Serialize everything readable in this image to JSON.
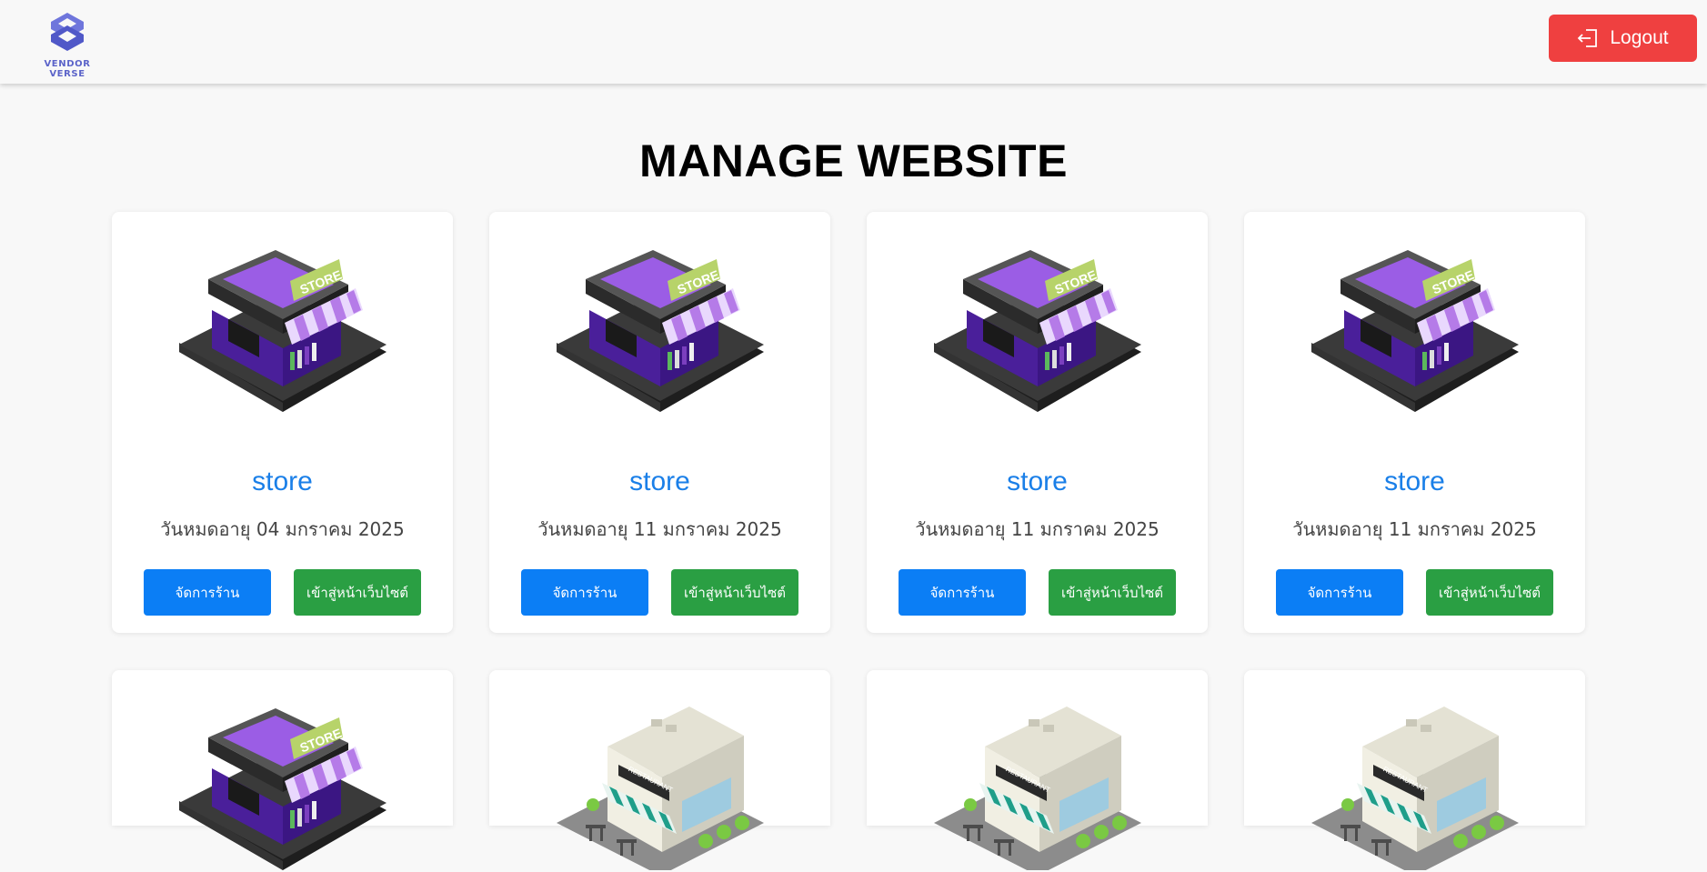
{
  "header": {
    "logo_text": "VENDOR VERSE",
    "logout_label": "Logout",
    "accent": "#ef4040"
  },
  "page": {
    "title": "MANAGE WEBSITE"
  },
  "stores": [
    {
      "name": "store",
      "expiry": "วันหมดอายุ 04 มกราคม 2025",
      "image": "store-illustration",
      "manage_label": "จัดการร้าน",
      "visit_label": "เข้าสู่หน้าเว็บไซต์"
    },
    {
      "name": "store",
      "expiry": "วันหมดอายุ 11 มกราคม 2025",
      "image": "store-illustration",
      "manage_label": "จัดการร้าน",
      "visit_label": "เข้าสู่หน้าเว็บไซต์"
    },
    {
      "name": "store",
      "expiry": "วันหมดอายุ 11 มกราคม 2025",
      "image": "store-illustration",
      "manage_label": "จัดการร้าน",
      "visit_label": "เข้าสู่หน้าเว็บไซต์"
    },
    {
      "name": "store",
      "expiry": "วันหมดอายุ 11 มกราคม 2025",
      "image": "store-illustration",
      "manage_label": "จัดการร้าน",
      "visit_label": "เข้าสู่หน้าเว็บไซต์"
    },
    {
      "image": "store-illustration"
    },
    {
      "image": "restaurant-illustration"
    },
    {
      "image": "restaurant-illustration"
    },
    {
      "image": "restaurant-illustration"
    }
  ],
  "colors": {
    "manage_button": "#0b7ef5",
    "visit_button": "#2a9f43",
    "store_name": "#1a7fe8"
  }
}
